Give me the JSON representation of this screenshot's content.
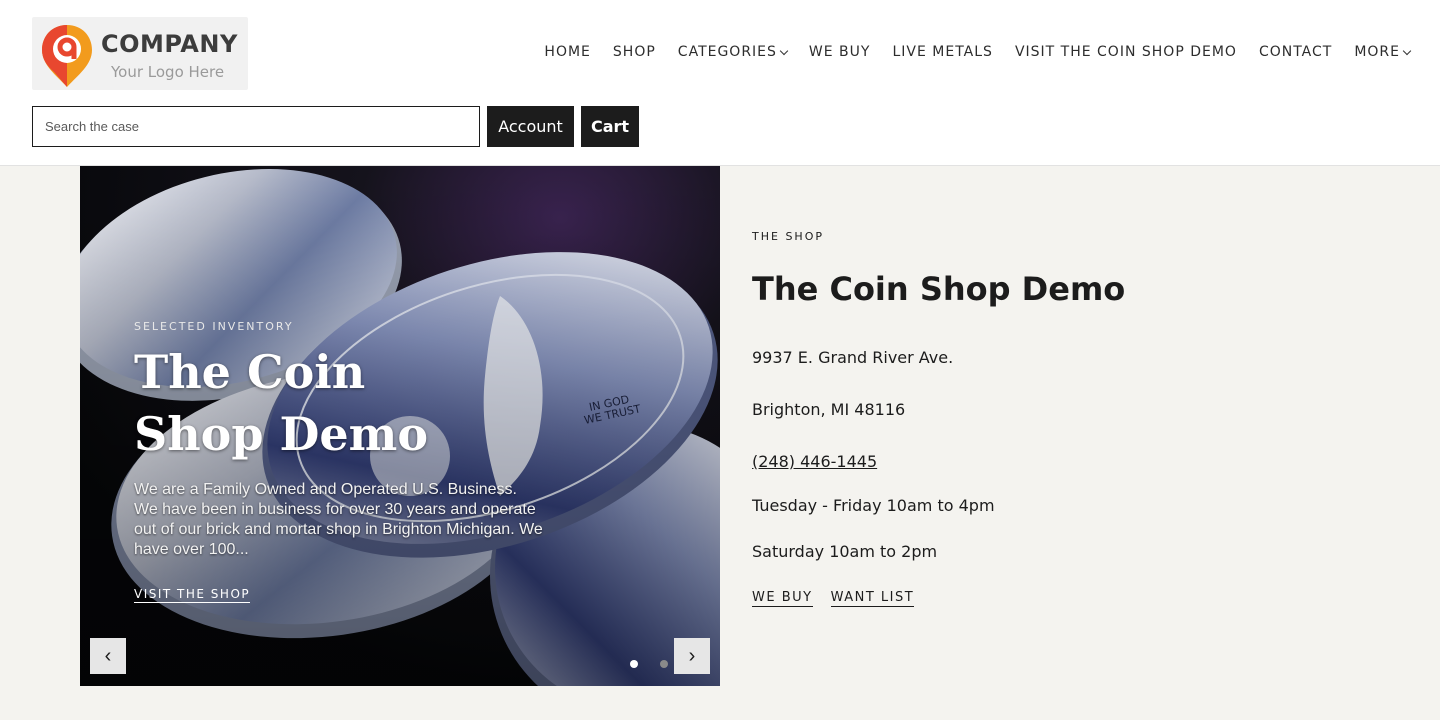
{
  "logo": {
    "wordmark": "COMPANY",
    "tagline": "Your Logo Here",
    "brand_color": "#e8472f",
    "accent_color": "#f29b1d"
  },
  "nav": {
    "items": [
      {
        "label": "HOME"
      },
      {
        "label": "SHOP"
      },
      {
        "label": "CATEGORIES",
        "dropdown": true
      },
      {
        "label": "WE BUY"
      },
      {
        "label": "LIVE METALS"
      },
      {
        "label": "VISIT THE COIN SHOP DEMO"
      },
      {
        "label": "CONTACT"
      },
      {
        "label": "MORE",
        "dropdown": true
      }
    ]
  },
  "search": {
    "placeholder": "Search the case",
    "value": ""
  },
  "header_buttons": {
    "account": "Account",
    "cart": "Cart"
  },
  "hero": {
    "eyebrow": "SELECTED INVENTORY",
    "title": "The Coin Shop Demo",
    "description": "We are a Family Owned and Operated U.S. Business. We have been in business for over 30 years and operate out of our brick and mortar shop in Brighton Michigan. We have over 100...",
    "link": "VISIT THE SHOP",
    "prev": "‹",
    "next": "›",
    "slides_total": 2,
    "slide_active": 1,
    "coin_inscription": "IN GOD WE TRUST"
  },
  "shop_info": {
    "eyebrow": "THE SHOP",
    "title": "The Coin Shop Demo",
    "address_line1": "9937 E. Grand River Ave.",
    "address_line2": "Brighton, MI 48116",
    "phone": "(248) 446-1445",
    "hours_weekday": "Tuesday - Friday 10am to 4pm",
    "hours_saturday": "Saturday 10am to 2pm",
    "links": [
      "WE BUY",
      "WANT LIST"
    ]
  },
  "colors": {
    "page_bg": "#f4f3ef",
    "header_bg": "#ffffff",
    "button_bg": "#1c1c1c",
    "text": "#1c1c1c"
  }
}
